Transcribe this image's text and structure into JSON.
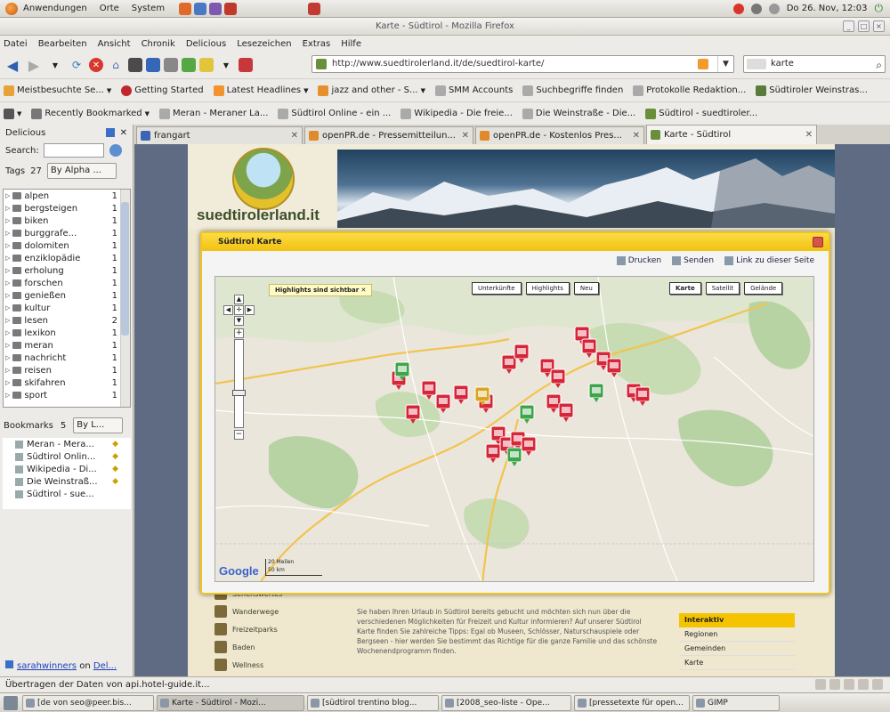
{
  "top_panel": {
    "menus": [
      "Anwendungen",
      "Orte",
      "System"
    ],
    "clock": "Do 26. Nov, 12:03"
  },
  "window": {
    "title": "Karte - Südtirol - Mozilla Firefox"
  },
  "menubar": [
    "Datei",
    "Bearbeiten",
    "Ansicht",
    "Chronik",
    "Delicious",
    "Lesezeichen",
    "Extras",
    "Hilfe"
  ],
  "navbar": {
    "url": "http://www.suedtirolerland.it/de/suedtirol-karte/",
    "search_value": "karte"
  },
  "bookmarks_toolbar": [
    "Meistbesuchte Se...",
    "Getting Started",
    "Latest Headlines",
    "jazz and other - S...",
    "SMM Accounts",
    "Suchbegriffe finden",
    "Protokolle Redaktion...",
    "Südtiroler Weinstras..."
  ],
  "bookmarks_toolbar2": [
    "Recently Bookmarked",
    "Meran - Meraner La...",
    "Südtirol Online - ein ...",
    "Wikipedia - Die freie...",
    "Die Weinstraße - Die...",
    "Südtirol - suedtiroler..."
  ],
  "sidebar": {
    "title": "Delicious",
    "search_label": "Search:",
    "tags_label": "Tags",
    "tags_count": "27",
    "tags_sort": "By Alpha ...",
    "tags": [
      {
        "name": "alpen",
        "count": "1"
      },
      {
        "name": "bergsteigen",
        "count": "1"
      },
      {
        "name": "biken",
        "count": "1"
      },
      {
        "name": "burggrafe...",
        "count": "1"
      },
      {
        "name": "dolomiten",
        "count": "1"
      },
      {
        "name": "enziklopädie",
        "count": "1"
      },
      {
        "name": "erholung",
        "count": "1"
      },
      {
        "name": "forschen",
        "count": "1"
      },
      {
        "name": "genießen",
        "count": "1"
      },
      {
        "name": "kultur",
        "count": "1"
      },
      {
        "name": "lesen",
        "count": "2"
      },
      {
        "name": "lexikon",
        "count": "1"
      },
      {
        "name": "meran",
        "count": "1"
      },
      {
        "name": "nachricht",
        "count": "1"
      },
      {
        "name": "reisen",
        "count": "1"
      },
      {
        "name": "skifahren",
        "count": "1"
      },
      {
        "name": "sport",
        "count": "1"
      }
    ],
    "bookmarks_label": "Bookmarks",
    "bookmarks_count": "5",
    "bookmarks_sort": "By L...",
    "bookmarks": [
      "Meran - Mera...",
      "Südtirol Onlin...",
      "Wikipedia - Di...",
      "Die Weinstraß...",
      "Südtirol - sue..."
    ],
    "footer_user": "sarahwinners",
    "footer_on": "on",
    "footer_service": "Del..."
  },
  "tabs": [
    {
      "label": "frangart",
      "color": "#3b66b5"
    },
    {
      "label": "openPR.de - Pressemitteilun...",
      "color": "#e08a2a"
    },
    {
      "label": "openPR.de - Kostenlos Pres...",
      "color": "#e08a2a"
    },
    {
      "label": "Karte - Südtirol",
      "color": "#6a8f3a"
    }
  ],
  "site": {
    "name": "suedtirolerland.it",
    "side_links": [
      "Sehenswertes",
      "Wanderwege",
      "Freizeitparks",
      "Baden",
      "Wellness"
    ],
    "text": "Sie haben Ihren Urlaub in Südtirol bereits gebucht und möchten sich nun über die verschiedenen Möglichkeiten für Freizeit und Kultur informieren? Auf unserer Südtirol Karte finden Sie zahlreiche Tipps: Egal ob Museen, Schlösser, Naturschauspiele oder Bergseen - hier werden Sie bestimmt das Richtige für die ganze Familie und das schönste Wochenendprogramm finden.",
    "right_head": "Interaktiv",
    "right_items": [
      "Regionen",
      "Gemeinden",
      "Karte"
    ]
  },
  "popup": {
    "title": "Südtirol Karte",
    "tools": [
      "Drucken",
      "Senden",
      "Link zu dieser Seite"
    ],
    "map": {
      "filter_buttons": [
        "Unterkünfte",
        "Highlights",
        "Neu"
      ],
      "type_buttons": [
        "Karte",
        "Satellit",
        "Gelände"
      ],
      "highlight_label": "Highlights sind sichtbar",
      "scale_top": "20 Meilen",
      "scale_bottom": "50 km",
      "logo": "Google"
    }
  },
  "statusbar": {
    "text": "Übertragen der Daten von api.hotel-guide.it..."
  },
  "taskbar": [
    "[de von seo@peer.bis...",
    "Karte - Südtirol - Mozi...",
    "[südtirol trentino blog...",
    "[2008_seo-liste - Ope...",
    "[pressetexte für open...",
    "GIMP"
  ]
}
